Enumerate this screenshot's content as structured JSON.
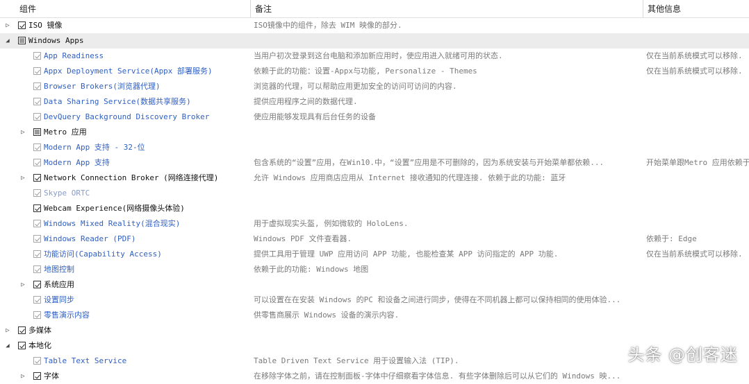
{
  "columns": [
    "组件",
    "备注",
    "其他信息"
  ],
  "rows": [
    {
      "level": 0,
      "expander": "collapsed",
      "check": "checked",
      "style": "black",
      "name": "ISO 镜像",
      "note": "ISO镜像中的组件，除去 WIM 映像的部分.",
      "other": ""
    },
    {
      "level": 0,
      "expander": "expanded",
      "check": "partial",
      "style": "black",
      "name": "Windows Apps",
      "note": "",
      "other": "",
      "selected": true
    },
    {
      "level": 1,
      "expander": "none",
      "check": "gray-checked",
      "style": "blue",
      "name": "App Readiness",
      "note": "当用户初次登录到这台电脑和添加新应用时，使应用进入就绪可用的状态.",
      "other": "仅在当前系统模式可以移除."
    },
    {
      "level": 1,
      "expander": "none",
      "check": "gray-checked",
      "style": "blue",
      "name": "Appx Deployment Service(Appx 部署服务)",
      "note": "依赖于此的功能：设置-Appx与功能, Personalize - Themes",
      "other": "仅在当前系统模式可以移除."
    },
    {
      "level": 1,
      "expander": "none",
      "check": "gray-checked",
      "style": "blue",
      "name": "Browser Brokers(浏览器代理)",
      "note": "浏览器的代理，可以帮助应用更加安全的访问可访问的内容.",
      "other": ""
    },
    {
      "level": 1,
      "expander": "none",
      "check": "gray-checked",
      "style": "blue",
      "name": "Data Sharing Service(数据共享服务)",
      "note": "提供应用程序之间的数据代理.",
      "other": ""
    },
    {
      "level": 1,
      "expander": "none",
      "check": "gray-checked",
      "style": "blue",
      "name": "DevQuery Background Discovery Broker",
      "note": "使应用能够发现具有后台任务的设备",
      "other": ""
    },
    {
      "level": 1,
      "expander": "collapsed",
      "check": "partial",
      "style": "black",
      "name": "Metro 应用",
      "note": "",
      "other": ""
    },
    {
      "level": 1,
      "expander": "none",
      "check": "gray-checked",
      "style": "blue",
      "name": "Modern App 支持 - 32-位",
      "note": "",
      "other": ""
    },
    {
      "level": 1,
      "expander": "none",
      "check": "gray-checked",
      "style": "blue",
      "name": "Modern App 支持",
      "note": "包含系统的“设置”应用，在Win10.中，“设置”应用是不可删除的，因为系统安装与开始菜单都依赖...",
      "other": "开始菜单跟Metro 应用依赖于"
    },
    {
      "level": 1,
      "expander": "collapsed",
      "check": "checked",
      "style": "black",
      "name": "Network Connection Broker (网络连接代理)",
      "note": "允许 Windows 应用商店应用从 Internet 接收通知的代理连接. 依赖于此的功能: 蓝牙",
      "other": ""
    },
    {
      "level": 1,
      "expander": "none",
      "check": "gray-checked",
      "style": "gray",
      "name": "Skype ORTC",
      "note": "",
      "other": ""
    },
    {
      "level": 1,
      "expander": "none",
      "check": "checked",
      "style": "black",
      "name": "Webcam Experience(网络摄像头体验)",
      "note": "",
      "other": ""
    },
    {
      "level": 1,
      "expander": "none",
      "check": "gray-checked",
      "style": "blue",
      "name": "Windows Mixed Reality(混合现实)",
      "note": "用于虚拟现实头盔, 例如微软的 HoloLens.",
      "other": ""
    },
    {
      "level": 1,
      "expander": "none",
      "check": "gray-checked",
      "style": "blue",
      "name": "Windows Reader (PDF)",
      "note": "Windows PDF 文件查看器.",
      "other": "依赖于: Edge"
    },
    {
      "level": 1,
      "expander": "none",
      "check": "gray-checked",
      "style": "blue",
      "name": "功能访问(Capability Access)",
      "note": "提供工具用于管理 UWP 应用访问 APP 功能, 也能检查某 APP 访问指定的 APP 功能.",
      "other": "仅在当前系统模式可以移除."
    },
    {
      "level": 1,
      "expander": "none",
      "check": "gray-checked",
      "style": "blue",
      "name": "地图控制",
      "note": "依赖于此的功能: Windows 地图",
      "other": ""
    },
    {
      "level": 1,
      "expander": "collapsed",
      "check": "checked",
      "style": "black",
      "name": "系统应用",
      "note": "",
      "other": ""
    },
    {
      "level": 1,
      "expander": "none",
      "check": "gray-checked",
      "style": "blue",
      "name": "设置同步",
      "note": "可以设置在在安装 Windows 的PC 和设备之间进行同步，使得在不同机器上都可以保持相同的使用体验...",
      "other": ""
    },
    {
      "level": 1,
      "expander": "none",
      "check": "gray-checked",
      "style": "blue",
      "name": "零售演示内容",
      "note": "供零售商展示 Windows 设备的演示内容.",
      "other": ""
    },
    {
      "level": 0,
      "expander": "collapsed",
      "check": "checked",
      "style": "black",
      "name": "多媒体",
      "note": "",
      "other": ""
    },
    {
      "level": 0,
      "expander": "expanded",
      "check": "checked",
      "style": "black",
      "name": "本地化",
      "note": "",
      "other": ""
    },
    {
      "level": 1,
      "expander": "none",
      "check": "gray-checked",
      "style": "blue",
      "name": "Table Text Service",
      "note": "Table Driven Text Service 用于设置输入法 (TIP).",
      "other": ""
    },
    {
      "level": 1,
      "expander": "collapsed",
      "check": "checked",
      "style": "black",
      "name": "字体",
      "note": "在移除字体之前，请在控制面板-字体中仔细察看字体信息. 有些字体删除后可以从它们的 Windows 映...",
      "other": ""
    }
  ],
  "watermark": "头条 @创客迷"
}
